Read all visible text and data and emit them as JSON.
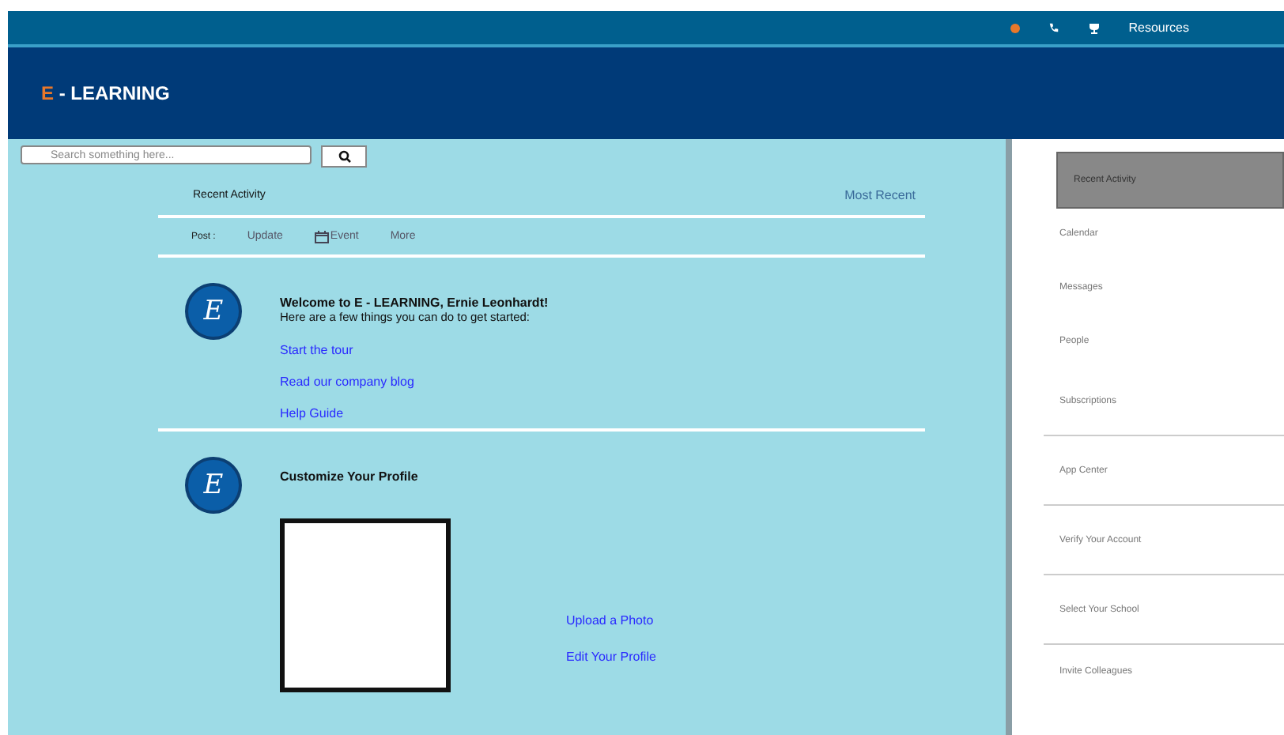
{
  "topbar": {
    "resources": "Resources"
  },
  "header": {
    "logo_mark": "E",
    "logo_rest": " - LEARNING"
  },
  "search": {
    "placeholder": "Search something here..."
  },
  "feed": {
    "title": "Recent Activity",
    "sort": "Most Recent",
    "post_tabs": [
      {
        "label": "Post :",
        "kind": "label"
      },
      {
        "label": "Update",
        "kind": "text"
      },
      {
        "label": "Event",
        "kind": "event"
      },
      {
        "label": "More",
        "kind": "text"
      }
    ],
    "cards": [
      {
        "kind": "welcome",
        "avatar": "E",
        "title": "Welcome to E - LEARNING, Ernie Leonhardt!",
        "subtitle": "Here are a few things you can do to get started:",
        "links": [
          "Start the tour",
          "Read our company blog",
          "Help Guide"
        ]
      },
      {
        "kind": "profile",
        "avatar": "E",
        "title": "Customize Your Profile",
        "links": [
          "Upload a Photo",
          "Edit Your Profile"
        ]
      }
    ]
  },
  "sidebar": {
    "items": [
      {
        "label": "Recent Activity",
        "selected": true,
        "divider": false
      },
      {
        "label": "Calendar",
        "selected": false,
        "divider": false
      },
      {
        "label": "Messages",
        "selected": false,
        "divider": false
      },
      {
        "label": "People",
        "selected": false,
        "divider": false
      },
      {
        "label": "Subscriptions",
        "selected": false,
        "divider": true
      },
      {
        "label": "App Center",
        "selected": false,
        "divider": true
      },
      {
        "label": "Verify Your Account",
        "selected": false,
        "divider": true
      },
      {
        "label": "Select Your School",
        "selected": false,
        "divider": true
      },
      {
        "label": "Invite Colleagues",
        "selected": false,
        "divider": false
      }
    ]
  }
}
